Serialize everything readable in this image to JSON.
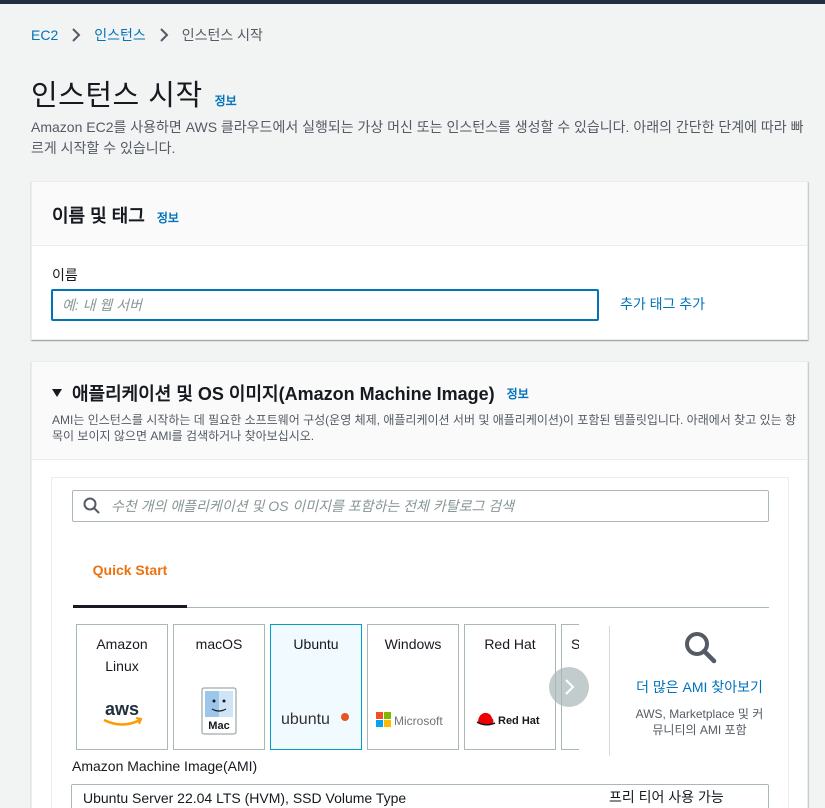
{
  "breadcrumb": {
    "items": [
      "EC2",
      "인스턴스"
    ],
    "current": "인스턴스 시작"
  },
  "page": {
    "title": "인스턴스 시작",
    "info": "정보",
    "description": "Amazon EC2를 사용하면 AWS 클라우드에서 실행되는 가상 머신 또는 인스턴스를 생성할 수 있습니다. 아래의 간단한 단계에 따라 빠르게 시작할 수 있습니다."
  },
  "name_panel": {
    "title": "이름 및 태그",
    "info": "정보",
    "name_label": "이름",
    "name_placeholder": "예: 내 웹 서버",
    "add_tag": "추가 태그 추가"
  },
  "ami_panel": {
    "title": "애플리케이션 및 OS 이미지(Amazon Machine Image)",
    "info": "정보",
    "description": "AMI는 인스턴스를 시작하는 데 필요한 소프트웨어 구성(운영 체제, 애플리케이션 서버 및 애플리케이션)이 포함된 템플릿입니다. 아래에서 찾고 있는 항목이 보이지 않으면 AMI를 검색하거나 찾아보십시오.",
    "search_placeholder": "수천 개의 애플리케이션 및 OS 이미지를 포함하는 전체 카탈로그 검색",
    "tab": "Quick Start",
    "os_options": [
      {
        "label": "Amazon Linux",
        "logo": "aws"
      },
      {
        "label": "macOS",
        "logo": "Mac"
      },
      {
        "label": "Ubuntu",
        "logo": "ubuntu",
        "selected": true
      },
      {
        "label": "Windows",
        "logo": "Microsoft"
      },
      {
        "label": "Red Hat",
        "logo": "Red Hat"
      },
      {
        "label": "S",
        "logo": ""
      }
    ],
    "more_ami": {
      "label": "더 많은 AMI 찾아보기",
      "sub": "AWS, Marketplace 및 커뮤니티의 AMI 포함"
    },
    "ami_label": "Amazon Machine Image(AMI)",
    "selected_ami": "Ubuntu Server 22.04 LTS (HVM), SSD Volume Type",
    "free_tier": "프리 티어 사용 가능"
  },
  "colors": {
    "link": "#0073bb",
    "accent_orange": "#ec7211",
    "selected_bg": "#f1faff",
    "selected_border": "#00a1c9",
    "topbar": "#232f3e"
  }
}
